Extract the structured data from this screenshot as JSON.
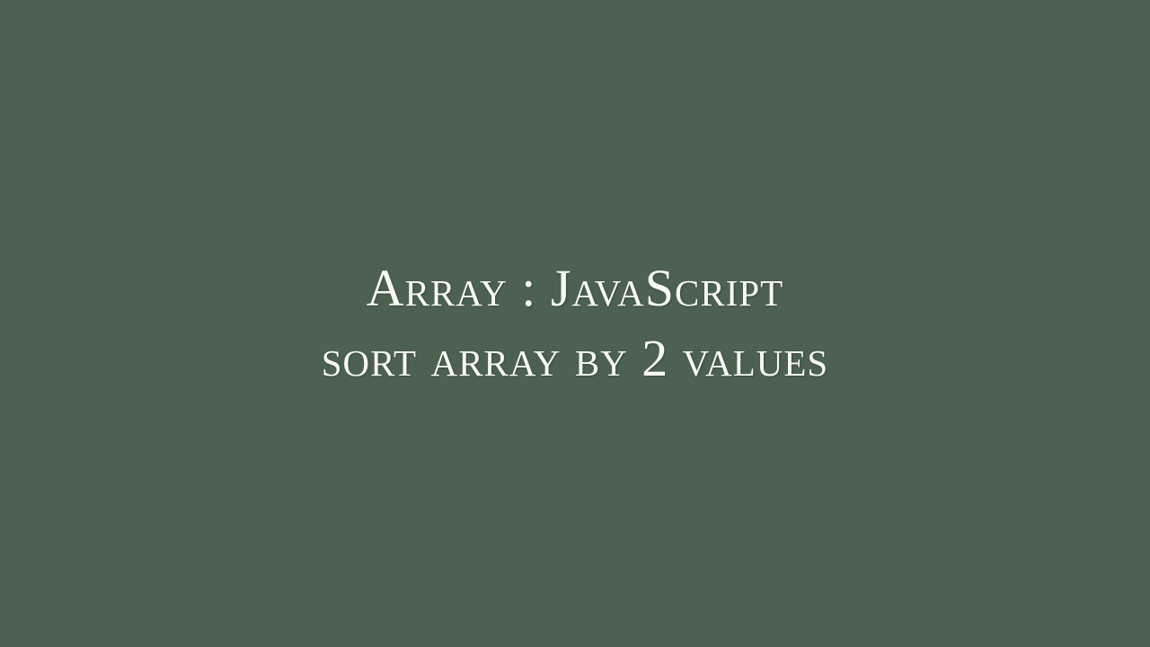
{
  "title": {
    "line1": "Array : JavaScript",
    "line2": "sort array by 2 values"
  },
  "colors": {
    "background": "#4d6151",
    "text": "#f8f8f5"
  }
}
